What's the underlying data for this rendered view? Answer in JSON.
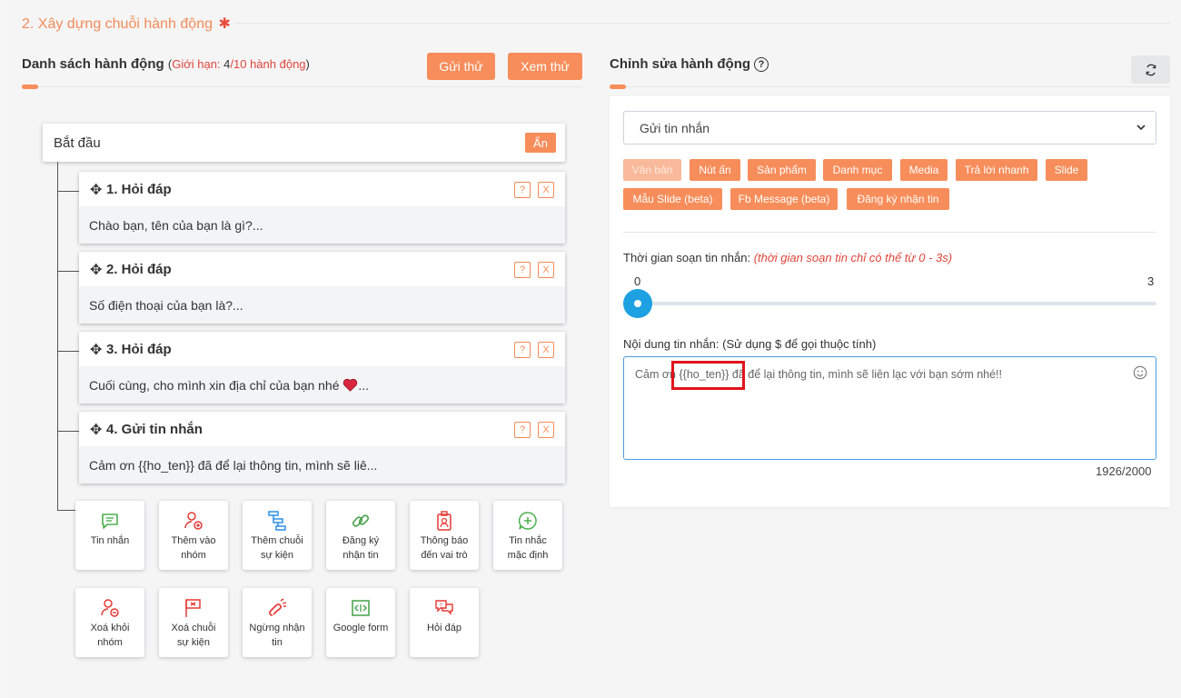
{
  "section": {
    "title": "2. Xây dựng chuỗi hành động",
    "required_mark": "✱"
  },
  "left": {
    "heading": "Danh sách hành động",
    "limit_open": "(",
    "limit_prefix": "Giới hạn: ",
    "limit_current": "4",
    "limit_rest": "/10 hành động",
    "limit_close": ")",
    "send_test_label": "Gửi thử",
    "preview_label": "Xem thử"
  },
  "tree": {
    "start_label": "Bắt đầu",
    "hide_label": "Ẩn",
    "help_label": "?",
    "delete_label": "X",
    "actions": [
      {
        "title": "1. Hỏi đáp",
        "body": "Chào bạn, tên của bạn là gì?..."
      },
      {
        "title": "2. Hỏi đáp",
        "body": "Số điện thoại của bạn là?..."
      },
      {
        "title": "3. Hỏi đáp",
        "body": "Cuối cùng, cho mình xin địa chỉ của bạn nhé",
        "body_suffix": "..."
      },
      {
        "title": "4. Gửi tin nhắn",
        "body": "Cảm ơn {{ho_ten}} đã để lại thông tin, mình sẽ liê..."
      }
    ]
  },
  "tiles": [
    {
      "label1": "Tin nhắn",
      "label2": "",
      "icon": "message-icon"
    },
    {
      "label1": "Thêm vào",
      "label2": "nhóm",
      "icon": "add-user-icon"
    },
    {
      "label1": "Thêm chuỗi",
      "label2": "sự kiện",
      "icon": "sequence-icon"
    },
    {
      "label1": "Đăng ký",
      "label2": "nhận tin",
      "icon": "link-icon"
    },
    {
      "label1": "Thông báo",
      "label2": "đến vai trò",
      "icon": "badge-icon"
    },
    {
      "label1": "Tin nhắc",
      "label2": "mặc định",
      "icon": "reminder-icon"
    },
    {
      "label1": "Xoá khỏi",
      "label2": "nhóm",
      "icon": "remove-user-icon"
    },
    {
      "label1": "Xoá chuỗi",
      "label2": "sự kiện",
      "icon": "remove-sequence-icon"
    },
    {
      "label1": "Ngừng nhận",
      "label2": "tin",
      "icon": "unsubscribe-icon"
    },
    {
      "label1": "Google form",
      "label2": "",
      "icon": "google-form-icon"
    },
    {
      "label1": "Hỏi đáp",
      "label2": "",
      "icon": "qa-icon"
    }
  ],
  "right": {
    "heading": "Chỉnh sửa hành động",
    "help_label": "?",
    "action_type": "Gửi tin nhắn",
    "tags": [
      "Văn bản",
      "Nút ấn",
      "Sản phẩm",
      "Danh mục",
      "Media",
      "Trả lời nhanh",
      "Slide",
      "Mẫu Slide (beta)",
      "Fb Message (beta)",
      "Đăng ký nhận tin"
    ],
    "compose_label": "Thời gian soạn tin nhắn: ",
    "compose_hint": "(thời gian soạn tin chỉ có thể từ 0 - 3s)",
    "slider_min": "0",
    "slider_max": "3",
    "slider_value": 0,
    "content_label": "Nội dung tin nhắn: (Sử dụng $ để gọi thuộc tính)",
    "content_value": "Cảm ơn {{ho_ten}} đã để lại thông tin, mình sẽ liên lạc với bạn sớm nhé!!",
    "counter": "1926/2000"
  },
  "colors": {
    "accent": "#f78d5a",
    "danger": "#e1131b",
    "slider": "#1da1e2"
  }
}
